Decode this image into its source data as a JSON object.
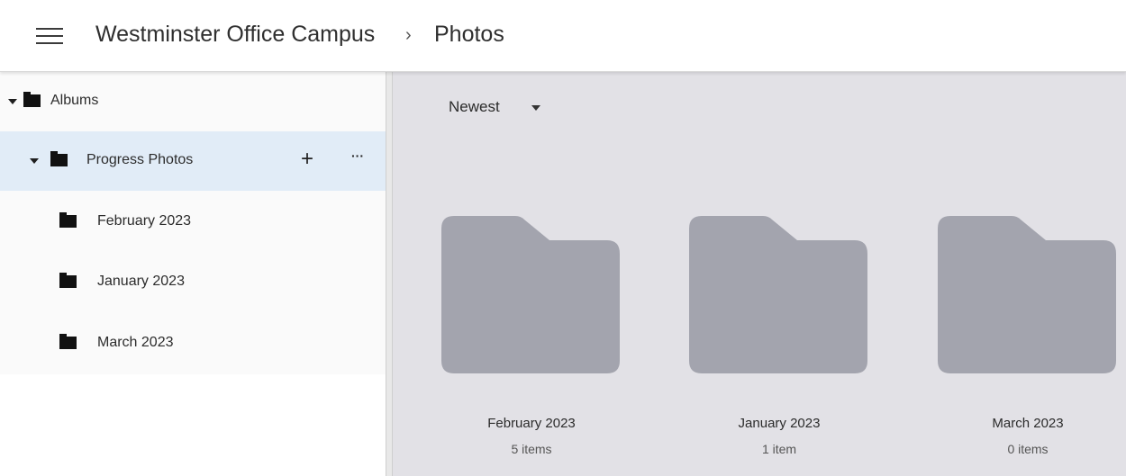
{
  "header": {
    "breadcrumb_root": "Westminster Office Campus",
    "breadcrumb_separator": "›",
    "breadcrumb_current": "Photos",
    "menu_icon": "hamburger-menu-icon"
  },
  "sidebar": {
    "tree": [
      {
        "label": "Albums",
        "expanded": true,
        "icon": "folder-icon"
      },
      {
        "label": "Progress Photos",
        "expanded": true,
        "selected": true,
        "icon": "folder-icon",
        "add_label": "+",
        "more_label": "···"
      },
      {
        "label": "February 2023",
        "icon": "folder-icon"
      },
      {
        "label": "January 2023",
        "icon": "folder-icon"
      },
      {
        "label": "March 2023",
        "icon": "folder-icon"
      }
    ]
  },
  "main": {
    "sort_label": "Newest",
    "folders": [
      {
        "name": "February 2023",
        "count": "5 items"
      },
      {
        "name": "January 2023",
        "count": "1 item"
      },
      {
        "name": "March 2023",
        "count": "0 items"
      }
    ]
  },
  "colors": {
    "selected_row": "#e1ecf7",
    "main_bg": "#e2e1e6",
    "folder_fill": "#a3a4ae"
  }
}
